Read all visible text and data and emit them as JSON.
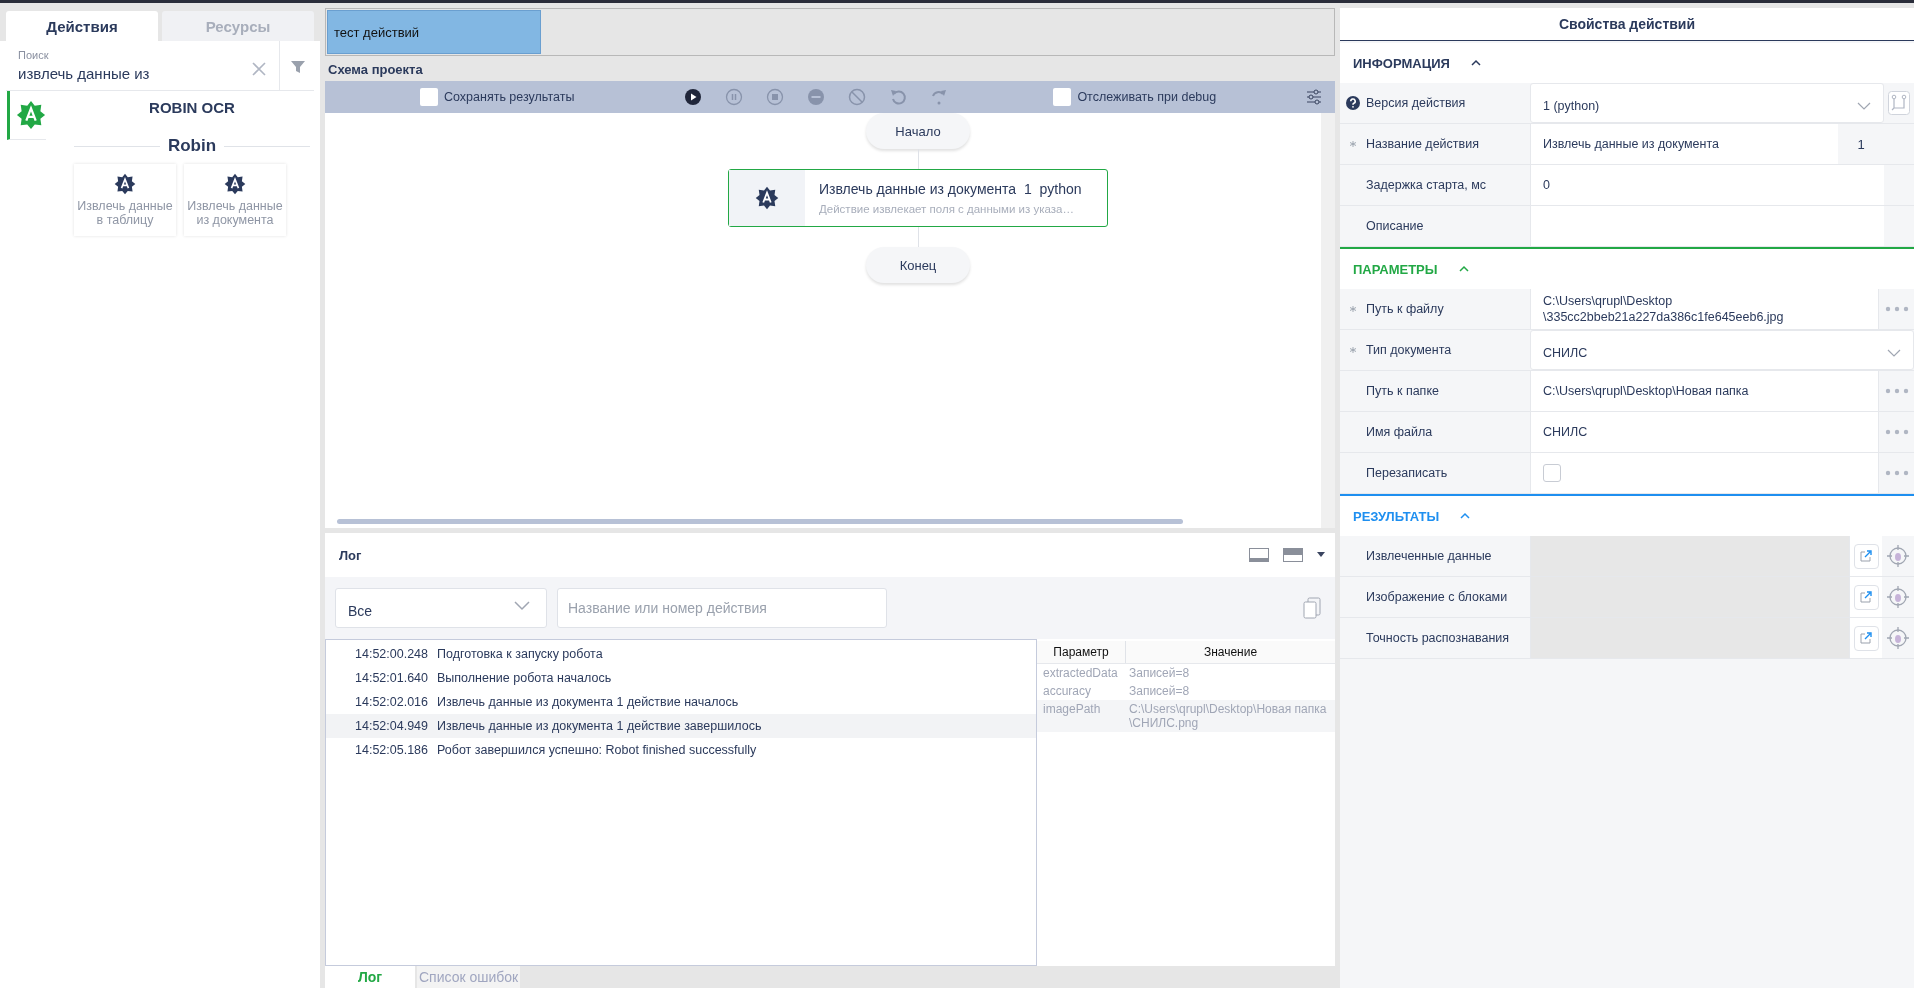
{
  "left_panel": {
    "tabs": [
      {
        "label": "Действия",
        "selected": true
      },
      {
        "label": "Ресурсы",
        "selected": false
      }
    ],
    "search": {
      "label": "Поиск",
      "value": "извлечь данные из"
    },
    "category_title": "ROBIN OCR",
    "group_title": "Robin",
    "actions": [
      {
        "label": "Извлечь данные в таблицу"
      },
      {
        "label": "Извлечь данные из документа"
      }
    ]
  },
  "document_tabs": [
    {
      "label": "тест действий",
      "selected": true
    }
  ],
  "schema": {
    "title": "Схема проекта",
    "save_results": {
      "label": "Сохранять результаты",
      "checked": false
    },
    "trace_debug": {
      "label": "Отслеживать при debug",
      "checked": false
    },
    "buttons": [
      {
        "kind": "play",
        "disabled": false
      },
      {
        "kind": "pause",
        "disabled": true
      },
      {
        "kind": "stop",
        "disabled": true
      },
      {
        "kind": "minus",
        "disabled": true
      },
      {
        "kind": "block",
        "disabled": true
      },
      {
        "kind": "undo",
        "disabled": true
      },
      {
        "kind": "redo",
        "disabled": true
      }
    ],
    "start": "Начало",
    "end": "Конец",
    "node": {
      "name": "Извлечь данные из документа",
      "number": "1",
      "language": "python",
      "description": "Действие извлекает поля с данными из указа…"
    }
  },
  "log": {
    "title": "Лог",
    "filter": "Все",
    "search_placeholder": "Название или номер действия",
    "entries": [
      {
        "time": "14:52:00.248",
        "message": "Подготовка к запуску робота",
        "selected": false
      },
      {
        "time": "14:52:01.640",
        "message": "Выполнение робота началось",
        "selected": false
      },
      {
        "time": "14:52:02.016",
        "message": "Извлечь данные из документа 1 действие началось",
        "selected": false
      },
      {
        "time": "14:52:04.949",
        "message": "Извлечь данные из документа 1 действие завершилось",
        "selected": true
      },
      {
        "time": "14:52:05.186",
        "message": "Робот завершился успешно: Robot finished successfully",
        "selected": false
      }
    ],
    "params": {
      "columns": [
        "Параметр",
        "Значение"
      ],
      "rows": [
        {
          "name": "extractedData",
          "value": "Записей=8"
        },
        {
          "name": "accuracy",
          "value": "Записей=8"
        },
        {
          "name": "imagePath",
          "value": "C:\\Users\\qrupl\\Desktop\\Новая папка\n\\СНИЛС.png"
        }
      ]
    },
    "bottom_tabs": [
      {
        "label": "Лог",
        "selected": true
      },
      {
        "label": "Список ошибок",
        "selected": false
      }
    ]
  },
  "properties": {
    "title": "Свойства действий",
    "sections": [
      {
        "title": "ИНФОРМАЦИЯ",
        "color": "#2b3a5c",
        "rows": [
          {
            "kind": "select",
            "label": "Версия действия",
            "value": "1 (python)",
            "help": true,
            "required": false
          },
          {
            "kind": "counter",
            "label": "Название действия",
            "value": "Извлечь данные из документа",
            "suffix": "1",
            "required": true
          },
          {
            "kind": "text",
            "label": "Задержка старта, мс",
            "value": "0",
            "required": false
          },
          {
            "kind": "text",
            "label": "Описание",
            "required": false
          }
        ]
      },
      {
        "title": "ПАРАМЕТРЫ",
        "color": "#22a845",
        "rows": [
          {
            "kind": "path",
            "label": "Путь к файлу",
            "value": "C:\\Users\\qrupl\\Desktop\n\\335cc2bbeb21a227da386c1fe645eeb6.jpg",
            "required": true
          },
          {
            "kind": "select",
            "label": "Тип документа",
            "value": "СНИЛС",
            "required": true
          },
          {
            "kind": "path",
            "label": "Путь к папке",
            "value": "C:\\Users\\qrupl\\Desktop\\Новая папка",
            "required": false
          },
          {
            "kind": "path",
            "label": "Имя файла",
            "value": "СНИЛС",
            "required": false
          },
          {
            "kind": "checkbox",
            "label": "Перезаписать",
            "checked": false,
            "required": false
          }
        ]
      },
      {
        "title": "РЕЗУЛЬТАТЫ",
        "color": "#1e8ff0",
        "rows": [
          {
            "kind": "output",
            "label": "Извлеченные данные",
            "required": false
          },
          {
            "kind": "output",
            "label": "Изображение с блоками",
            "required": false
          },
          {
            "kind": "output",
            "label": "Точность распознавания",
            "required": false
          }
        ]
      }
    ]
  }
}
